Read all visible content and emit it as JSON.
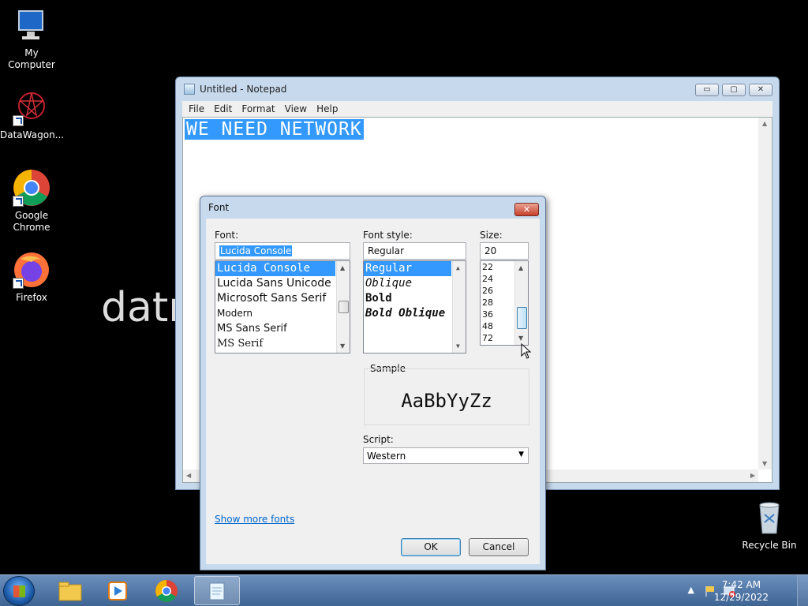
{
  "desktop": {
    "icons": [
      {
        "label": "My Computer",
        "icon": "computer-icon"
      },
      {
        "label": "DataWagon...",
        "icon": "datawagon-icon"
      },
      {
        "label": "Google Chrome",
        "icon": "chrome-icon"
      },
      {
        "label": "Firefox",
        "icon": "firefox-icon"
      },
      {
        "label": "Recycle Bin",
        "icon": "recycle-bin-icon"
      }
    ],
    "wallpaper_text": "datr"
  },
  "notepad": {
    "title": "Untitled - Notepad",
    "menu": [
      "File",
      "Edit",
      "Format",
      "View",
      "Help"
    ],
    "content": "WE NEED NETWORK",
    "buttons": {
      "minimize": "▭",
      "maximize": "▢",
      "close": "✕"
    }
  },
  "font_dialog": {
    "title": "Font",
    "close": "✕",
    "font_label": "Font:",
    "font_value": "Lucida Console",
    "fonts": [
      "Lucida Console",
      "Lucida Sans Unicode",
      "Microsoft Sans Serif",
      "Modern",
      "MS Sans Serif",
      "MS Serif"
    ],
    "style_label": "Font style:",
    "style_value": "Regular",
    "styles": [
      "Regular",
      "Oblique",
      "Bold",
      "Bold Oblique"
    ],
    "size_label": "Size:",
    "size_value": "20",
    "sizes": [
      "22",
      "24",
      "26",
      "28",
      "36",
      "48",
      "72"
    ],
    "sample_label": "Sample",
    "sample_text": "AaBbYyZz",
    "script_label": "Script:",
    "script_value": "Western",
    "show_more_fonts": "Show more fonts",
    "ok": "OK",
    "cancel": "Cancel"
  },
  "taskbar": {
    "clock_time": "7:42 AM",
    "clock_date": "12/29/2022",
    "tray_chevron": "▲"
  },
  "colors": {
    "selection": "#3399ff",
    "link": "#0066cc",
    "title_bar": "#c7d9ec"
  }
}
